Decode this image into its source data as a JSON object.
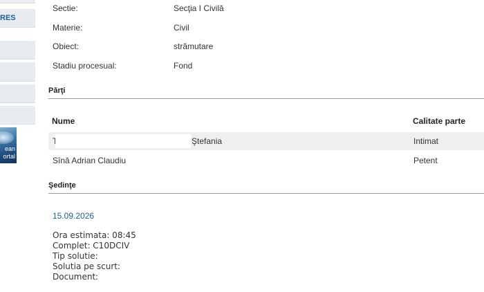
{
  "sidebar": {
    "highlighted_label": "RES",
    "banner_text": [
      "ean",
      "ortal"
    ]
  },
  "case_info": [
    {
      "label": "Sectie:",
      "value": "Secţia I Civilă"
    },
    {
      "label": "Materie:",
      "value": "Civil"
    },
    {
      "label": "Obiect:",
      "value": "strămutare"
    },
    {
      "label": "Stadiu procesual:",
      "value": "Fond"
    }
  ],
  "parties_section": {
    "title": "Părţi",
    "columns": [
      "Nume",
      "Calitate parte"
    ],
    "rows": [
      {
        "name_initial": "T",
        "name_rest": "Ştefania",
        "role": "Intimat",
        "redacted": true
      },
      {
        "name": "Sînă Adrian Claudiu",
        "role": "Petent"
      }
    ]
  },
  "hearings_section": {
    "title": "Şedinţe",
    "hearing": {
      "date": "15.09.2026",
      "details": [
        "Ora estimata: 08:45",
        "Complet: C10DCIV",
        "Tip solutie:",
        "Solutia pe scurt:",
        "Document:"
      ]
    }
  }
}
